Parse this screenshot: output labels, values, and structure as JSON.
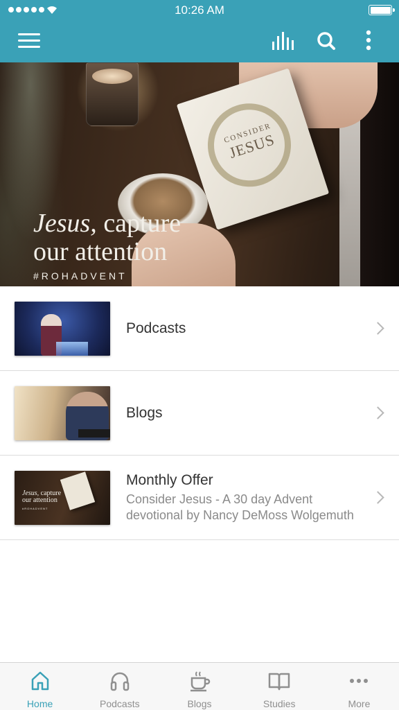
{
  "status_bar": {
    "time": "10:26 AM"
  },
  "colors": {
    "accent": "#3aa1b7",
    "tab_inactive": "#8f8f8f",
    "subtitle": "#8a8a8a"
  },
  "header": {
    "icons": [
      "menu-icon",
      "equalizer-icon",
      "search-icon",
      "more-vertical-icon"
    ]
  },
  "hero": {
    "line1_italic": "Jesus,",
    "line1_rest": " capture",
    "line2": "our attention",
    "hashtag": "#ROHADVENT",
    "book_title_small": "CONSIDER",
    "book_title": "JESUS"
  },
  "list": {
    "items": [
      {
        "title": "Podcasts"
      },
      {
        "title": "Blogs"
      },
      {
        "title": "Monthly Offer",
        "subtitle_line1": "Consider Jesus - A 30 day Advent",
        "subtitle_line2": "devotional by Nancy DeMoss Wolgemuth",
        "thumb_line1_italic": "Jesus,",
        "thumb_line1_rest": " capture",
        "thumb_line2": "our attention",
        "thumb_tag": "#ROHADVENT"
      }
    ]
  },
  "tabs": [
    {
      "label": "Home",
      "icon": "home-icon",
      "active": true
    },
    {
      "label": "Podcasts",
      "icon": "headphones-icon",
      "active": false
    },
    {
      "label": "Blogs",
      "icon": "coffee-cup-icon",
      "active": false
    },
    {
      "label": "Studies",
      "icon": "open-book-icon",
      "active": false
    },
    {
      "label": "More",
      "icon": "more-dots-icon",
      "active": false
    }
  ]
}
